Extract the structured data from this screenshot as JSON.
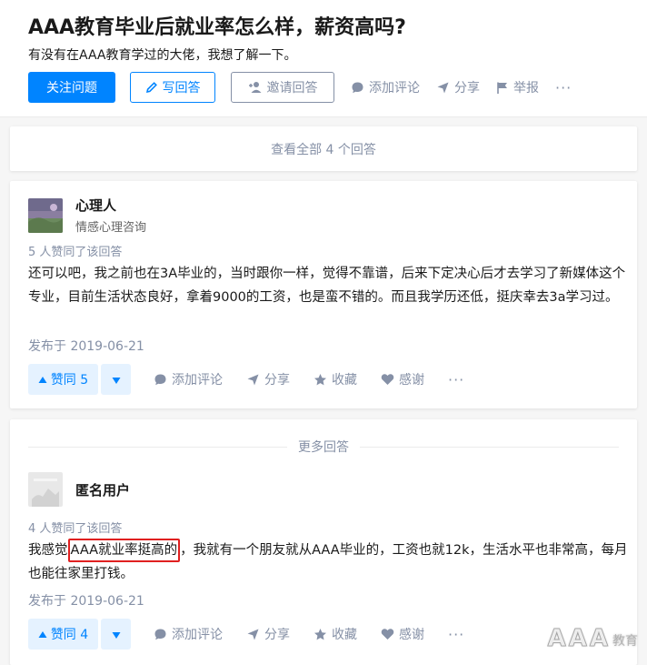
{
  "question": {
    "title": "AAA教育毕业后就业率怎么样，薪资高吗?",
    "detail": "有没有在AAA教育学过的大佬，我想了解一下。",
    "actions": {
      "follow": "关注问题",
      "write": "写回答",
      "invite": "邀请回答",
      "comment": "添加评论",
      "share": "分享",
      "report": "举报",
      "more": "···"
    }
  },
  "view_all": "查看全部 4 个回答",
  "more_answers": "更多回答",
  "answers": [
    {
      "author_name": "心理人",
      "author_desc": "情感心理咨询",
      "votes_text": "5 人赞同了该回答",
      "content": "还可以吧，我之前也在3A毕业的，当时跟你一样，觉得不靠谱，后来下定决心后才去学习了新媒体这个专业，目前生活状态良好，拿着9000的工资，也是蛮不错的。而且我学历还低，挺庆幸去3a学习过。",
      "date": "发布于 2019-06-21",
      "vote_label": "赞同 5",
      "comment": "添加评论",
      "share": "分享",
      "collect": "收藏",
      "thanks": "感谢",
      "more": "···"
    },
    {
      "author_name": "匿名用户",
      "author_desc": "",
      "votes_text": "4 人赞同了该回答",
      "content_before": "我感觉",
      "content_highlight": "AAA就业率挺高的",
      "content_after": "，我就有一个朋友就从AAA毕业的，工资也就12k，生活水平也非常高，每月也能往家里打钱。",
      "date": "发布于 2019-06-21",
      "vote_label": "赞同 4",
      "comment": "添加评论",
      "share": "分享",
      "collect": "收藏",
      "thanks": "感谢",
      "more": "···"
    }
  ],
  "watermark": {
    "main": "AAA",
    "sub": "教育"
  },
  "colors": {
    "primary": "#0084ff",
    "muted": "#8590a6",
    "highlight_border": "#e02020",
    "page_bg": "#f6f6f6"
  }
}
